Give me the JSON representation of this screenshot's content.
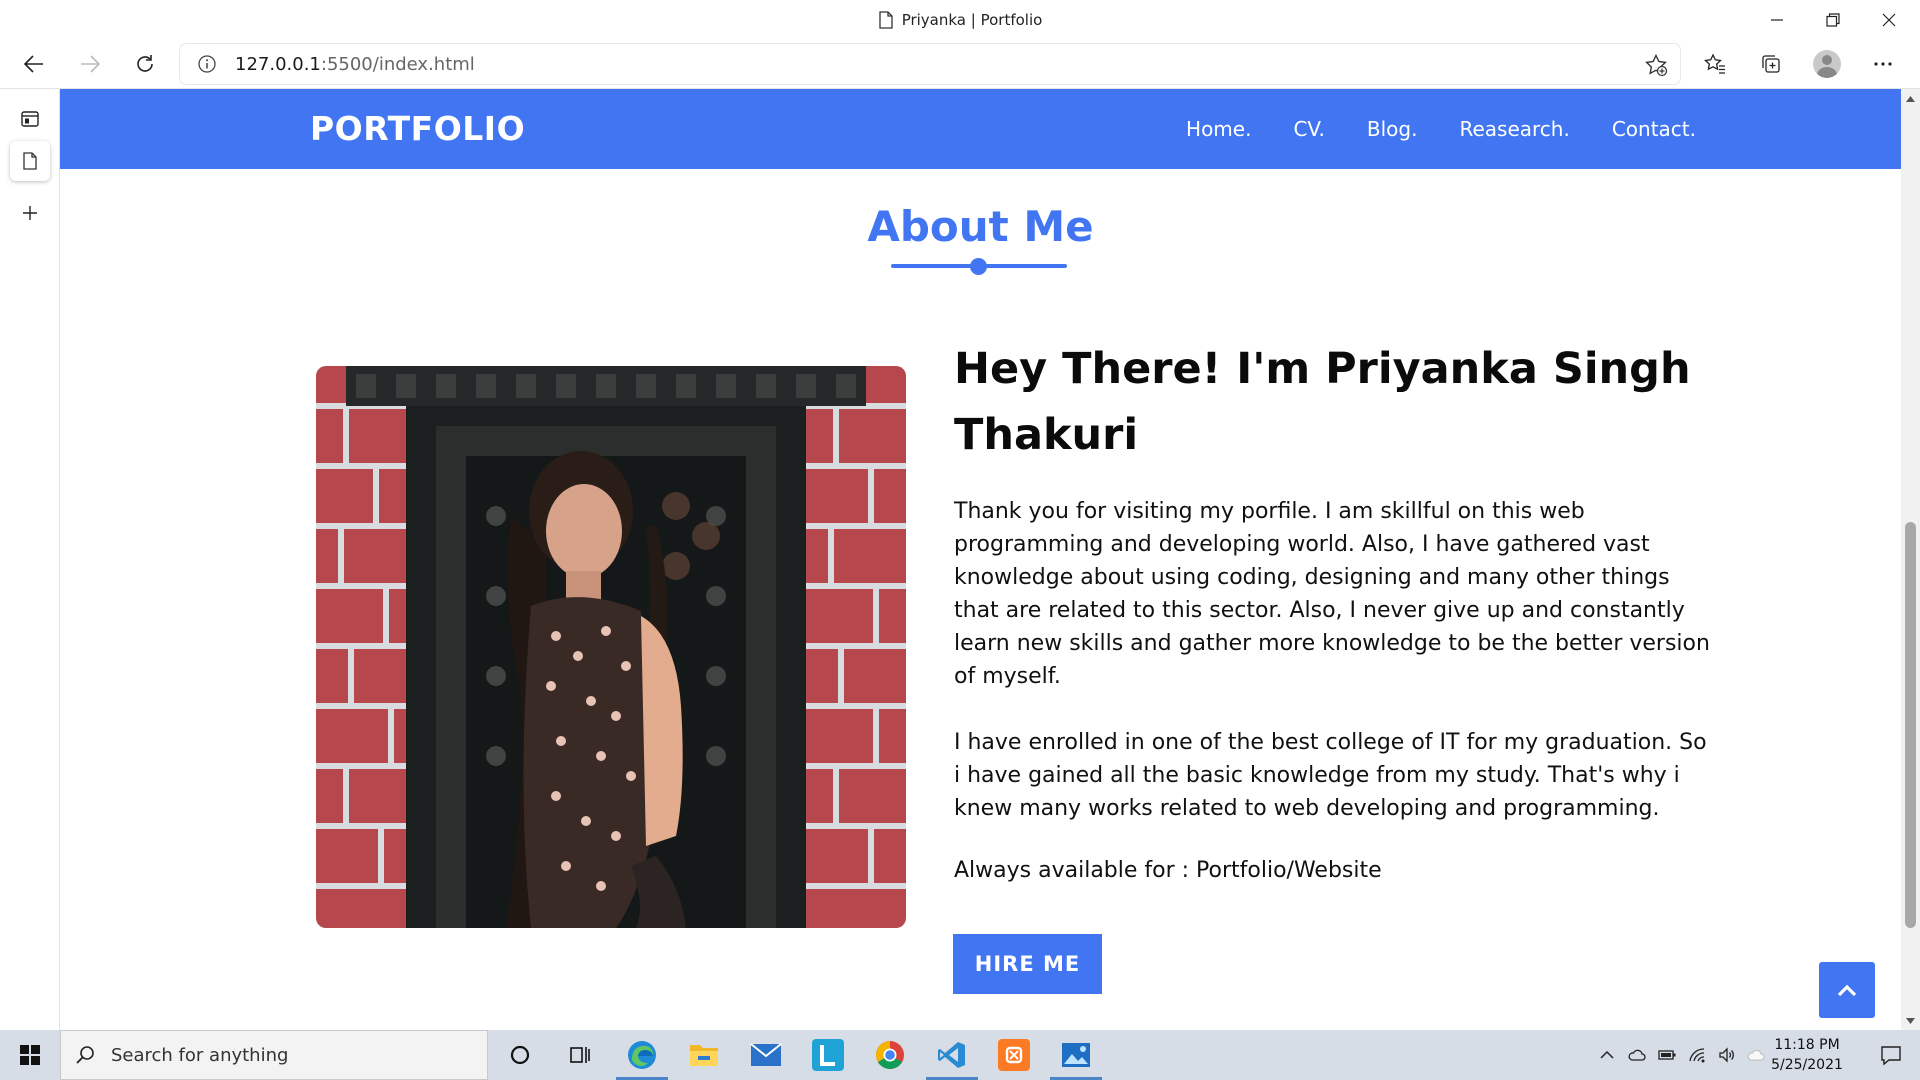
{
  "browser": {
    "tab_title": "Priyanka | Portfolio",
    "url_host": "127.0.0.1",
    "url_path": ":5500/index.html"
  },
  "site": {
    "brand": "PORTFOLIO",
    "menu": [
      {
        "label": "Home."
      },
      {
        "label": "CV."
      },
      {
        "label": "Blog."
      },
      {
        "label": "Reasearch."
      },
      {
        "label": "Contact."
      }
    ],
    "accent_color": "#4175f2"
  },
  "about": {
    "section_title": "About Me",
    "headline": "Hey There! I'm Priyanka Singh Thakuri",
    "paragraph1": "Thank you for visiting my porfile. I am skillful on this web programming and developing world. Also, I have gathered vast knowledge about using coding, designing and many other things that are related to this sector. Also, I never give up and constantly learn new skills and gather more knowledge to be the better version of myself.",
    "paragraph2": "I have enrolled in one of the best college of IT for my graduation. So i have gained all the basic knowledge from my study. That's why i knew many works related to web developing and programming.",
    "availability": "Always available for : Portfolio/Website",
    "hire_button": "HIRE ME"
  },
  "taskbar": {
    "search_placeholder": "Search for anything",
    "time": "11:18 PM",
    "date": "5/25/2021",
    "apps": [
      "cortana-icon",
      "task-view-icon",
      "edge-icon",
      "file-explorer-icon",
      "mail-icon",
      "l-app-icon",
      "chrome-icon",
      "vscode-icon",
      "xampp-icon",
      "photos-icon"
    ]
  }
}
